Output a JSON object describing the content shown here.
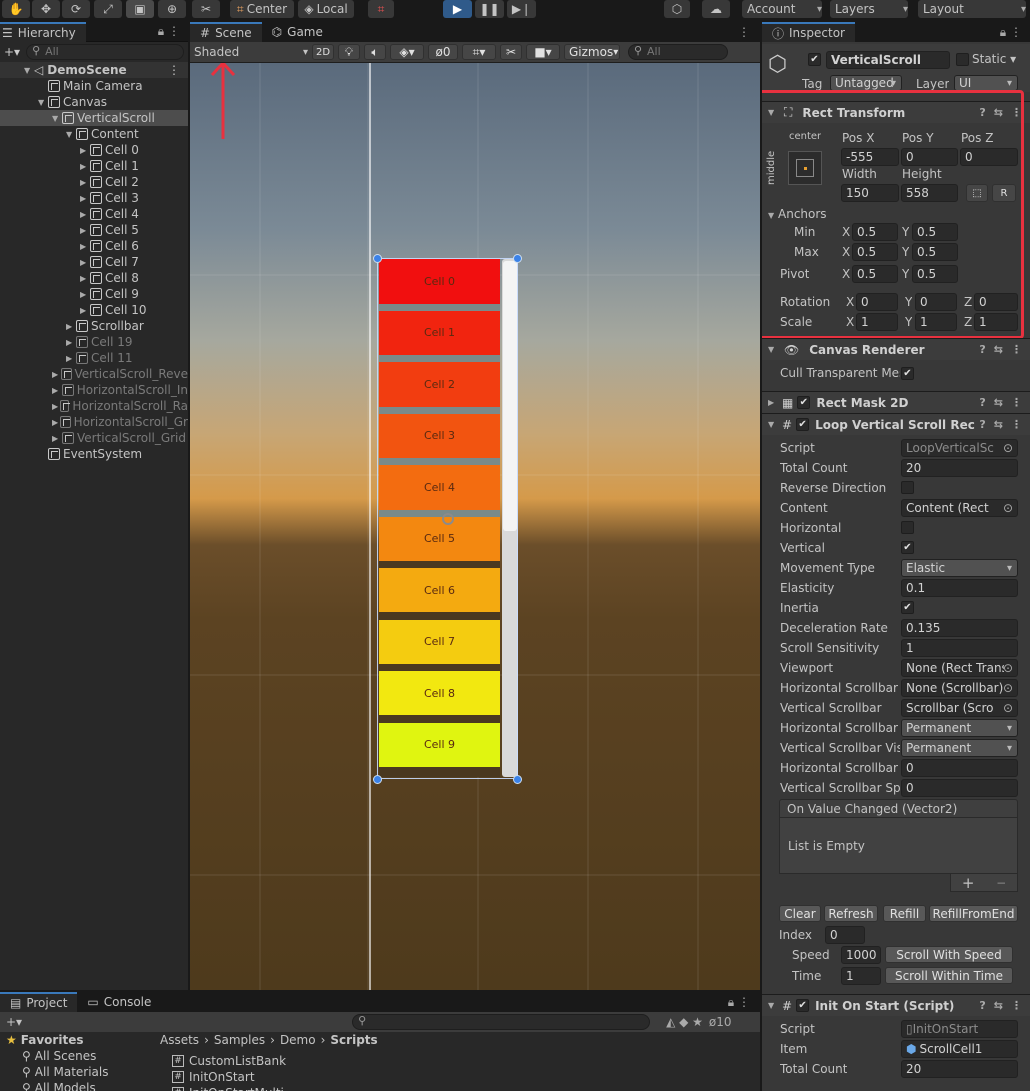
{
  "toolbar": {
    "center_label": "Center",
    "local_label": "Local",
    "account_label": "Account",
    "layers_label": "Layers",
    "layout_label": "Layout"
  },
  "hierarchy": {
    "tab_label": "Hierarchy",
    "search_placeholder": "All",
    "scene_name": "DemoScene",
    "items": [
      {
        "label": "Main Camera",
        "dim": false,
        "selected": false
      },
      {
        "label": "Canvas",
        "dim": false,
        "selected": false
      },
      {
        "label": "VerticalScroll",
        "dim": false,
        "selected": true
      },
      {
        "label": "Content",
        "dim": false,
        "selected": false
      },
      {
        "label": "Cell 0",
        "dim": false,
        "selected": false
      },
      {
        "label": "Cell 1",
        "dim": false,
        "selected": false
      },
      {
        "label": "Cell 2",
        "dim": false,
        "selected": false
      },
      {
        "label": "Cell 3",
        "dim": false,
        "selected": false
      },
      {
        "label": "Cell 4",
        "dim": false,
        "selected": false
      },
      {
        "label": "Cell 5",
        "dim": false,
        "selected": false
      },
      {
        "label": "Cell 6",
        "dim": false,
        "selected": false
      },
      {
        "label": "Cell 7",
        "dim": false,
        "selected": false
      },
      {
        "label": "Cell 8",
        "dim": false,
        "selected": false
      },
      {
        "label": "Cell 9",
        "dim": false,
        "selected": false
      },
      {
        "label": "Cell 10",
        "dim": false,
        "selected": false
      },
      {
        "label": "Scrollbar",
        "dim": false,
        "selected": false
      },
      {
        "label": "Cell 19",
        "dim": true,
        "selected": false
      },
      {
        "label": "Cell 11",
        "dim": true,
        "selected": false
      },
      {
        "label": "VerticalScroll_Reve",
        "dim": true,
        "selected": false
      },
      {
        "label": "HorizontalScroll_In",
        "dim": true,
        "selected": false
      },
      {
        "label": "HorizontalScroll_Ra",
        "dim": true,
        "selected": false
      },
      {
        "label": "HorizontalScroll_Gr",
        "dim": true,
        "selected": false
      },
      {
        "label": "VerticalScroll_Grid",
        "dim": true,
        "selected": false
      },
      {
        "label": "EventSystem",
        "dim": false,
        "selected": false
      }
    ]
  },
  "scene": {
    "tab_scene": "Scene",
    "tab_game": "Game",
    "shading_mode": "Shaded",
    "btn_2d": "2D",
    "hidden_count": "0",
    "gizmos_label": "Gizmos",
    "search_placeholder": "All",
    "cells": [
      {
        "label": "Cell 0",
        "color": "#f10f0f"
      },
      {
        "label": "Cell 1",
        "color": "#f1240f"
      },
      {
        "label": "Cell 2",
        "color": "#f23d10"
      },
      {
        "label": "Cell 3",
        "color": "#f25410"
      },
      {
        "label": "Cell 4",
        "color": "#f36c10"
      },
      {
        "label": "Cell 5",
        "color": "#f38810"
      },
      {
        "label": "Cell 6",
        "color": "#f4aa10"
      },
      {
        "label": "Cell 7",
        "color": "#f4cc10"
      },
      {
        "label": "Cell 8",
        "color": "#f2e810"
      },
      {
        "label": "Cell 9",
        "color": "#e0f510"
      }
    ]
  },
  "inspector": {
    "tab_label": "Inspector",
    "object_name": "VerticalScroll",
    "static_label": "Static",
    "tag_label": "Tag",
    "tag_value": "Untagged",
    "layer_label": "Layer",
    "layer_value": "UI",
    "rect_transform": {
      "title": "Rect Transform",
      "anchor_h": "center",
      "anchor_v": "middle",
      "pos_x_label": "Pos X",
      "pos_x": "-555",
      "pos_y_label": "Pos Y",
      "pos_y": "0",
      "pos_z_label": "Pos Z",
      "pos_z": "0",
      "width_label": "Width",
      "width": "150",
      "height_label": "Height",
      "height": "558",
      "r_button": "R",
      "anchors_label": "Anchors",
      "min_label": "Min",
      "min_x": "0.5",
      "min_y": "0.5",
      "max_label": "Max",
      "max_x": "0.5",
      "max_y": "0.5",
      "pivot_label": "Pivot",
      "pivot_x": "0.5",
      "pivot_y": "0.5",
      "rotation_label": "Rotation",
      "rot_x": "0",
      "rot_y": "0",
      "rot_z": "0",
      "scale_label": "Scale",
      "scale_x": "1",
      "scale_y": "1",
      "scale_z": "1",
      "x": "X",
      "y": "Y",
      "z": "Z"
    },
    "canvas_renderer": {
      "title": "Canvas Renderer",
      "cull_label": "Cull Transparent Mes"
    },
    "rect_mask": {
      "title": "Rect Mask 2D"
    },
    "loop_scroll": {
      "title": "Loop Vertical Scroll Rec",
      "fields": [
        {
          "label": "Script",
          "value": "LoopVerticalSc",
          "kind": "obj",
          "dim": true
        },
        {
          "label": "Total Count",
          "value": "20",
          "kind": "text"
        },
        {
          "label": "Reverse Direction",
          "value": "",
          "kind": "check_off"
        },
        {
          "label": "Content",
          "value": "Content (Rect",
          "kind": "obj"
        },
        {
          "label": "Horizontal",
          "value": "",
          "kind": "check_off"
        },
        {
          "label": "Vertical",
          "value": "",
          "kind": "check_on"
        },
        {
          "label": "Movement Type",
          "value": "Elastic",
          "kind": "dropdown"
        },
        {
          "label": "Elasticity",
          "value": "0.1",
          "kind": "text"
        },
        {
          "label": "Inertia",
          "value": "",
          "kind": "check_on"
        },
        {
          "label": "Deceleration Rate",
          "value": "0.135",
          "kind": "text"
        },
        {
          "label": "Scroll Sensitivity",
          "value": "1",
          "kind": "text"
        },
        {
          "label": "Viewport",
          "value": "None (Rect Trans",
          "kind": "obj"
        },
        {
          "label": "Horizontal Scrollbar",
          "value": "None (Scrollbar)",
          "kind": "obj"
        },
        {
          "label": "Vertical Scrollbar",
          "value": "Scrollbar (Scro",
          "kind": "obj"
        },
        {
          "label": "Horizontal Scrollbar V",
          "value": "Permanent",
          "kind": "dropdown"
        },
        {
          "label": "Vertical Scrollbar Visi",
          "value": "Permanent",
          "kind": "dropdown"
        },
        {
          "label": "Horizontal Scrollbar S",
          "value": "0",
          "kind": "text"
        },
        {
          "label": "Vertical Scrollbar Spa",
          "value": "0",
          "kind": "text"
        }
      ],
      "event_title": "On Value Changed (Vector2)",
      "event_empty": "List is Empty",
      "plus": "+",
      "minus": "−",
      "btn_clear": "Clear",
      "btn_refresh": "Refresh",
      "btn_refill": "Refill",
      "btn_refill_end": "RefillFromEnd",
      "index_label": "Index",
      "index_value": "0",
      "speed_label": "Speed",
      "speed_value": "1000",
      "btn_scroll_speed": "Scroll With Speed",
      "time_label": "Time",
      "time_value": "1",
      "btn_scroll_time": "Scroll Within Time"
    },
    "init_on_start": {
      "title": "Init On Start (Script)",
      "script_label": "Script",
      "script_value": "InitOnStart",
      "item_label": "Item",
      "item_value": "ScrollCell1",
      "total_label": "Total Count",
      "total_value": "20"
    }
  },
  "project": {
    "tab_project": "Project",
    "tab_console": "Console",
    "hidden_count": "10",
    "favorites_label": "Favorites",
    "favorites": [
      "All Scenes",
      "All Materials",
      "All Models"
    ],
    "breadcrumb": [
      "Assets",
      "Samples",
      "Demo",
      "Scripts"
    ],
    "files": [
      "CustomListBank",
      "InitOnStart",
      "InitOnStartMulti"
    ]
  },
  "colors": {
    "accent": "#3a79bb",
    "highlight_box": "#e8313f",
    "play_active": "#2f5a8a"
  }
}
